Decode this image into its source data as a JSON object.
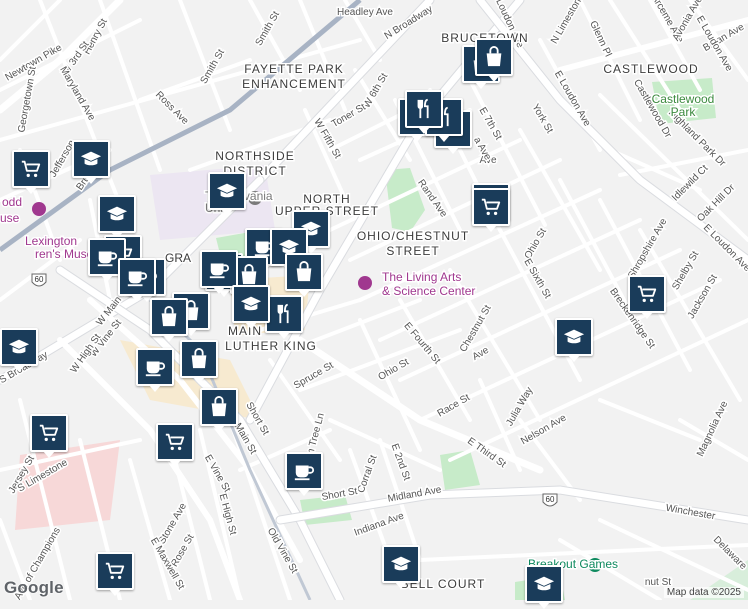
{
  "map": {
    "neighborhoods": [
      "BRUCETOWN",
      "CASTLEWOOD",
      "FAYETTE PARK",
      "ENHANCEMENT",
      "NORTHSIDE",
      "DISTRICT",
      "NORTH",
      "UPPER STREET",
      "OHIO/CHESTNUT",
      "STREET",
      "MAIN",
      "LUTHER KING",
      "BELL COURT"
    ],
    "places": [
      "Transylvania",
      "Univ",
      "Lexington",
      "ren's Museum",
      "The Living Arts",
      "& Science Center",
      "Castlewood",
      "Park",
      "Breakout Games",
      "odd",
      "use",
      "GRA"
    ],
    "streets": [
      "Henry St",
      "W 3rd St",
      "Newtown Pike",
      "Maryland Ave",
      "Georgetown St",
      "Jefferson",
      "Bruce St",
      "Ross Ave",
      "Smith St",
      "Smith St",
      "Headley Ave",
      "N Broadway",
      "N Loudon Ave",
      "N Limestone",
      "Arceme Ave",
      "Bryan Ave",
      "Glenn Pl",
      "Avonia Ave",
      "E Loudon Ave",
      "W 6th St",
      "Toner St",
      "E 7th St",
      "W Fifth St",
      "Rand Ave",
      "York St",
      "Castlewood Dr",
      "Highland Park Dr",
      "E Loudon Ave",
      "Idlewild Ct",
      "Oak Hill Dr",
      "E Loudon Ave",
      "Ohio St",
      "Shropshire Ave",
      "Shelby St",
      "Jackson St",
      "E Sixth St",
      "Breckenridge St",
      "W Main St",
      "W Vine St",
      "W High St",
      "S Broadway",
      "E Fourth St",
      "Ohio St",
      "Race St",
      "Julia Way",
      "Spruce St",
      "Short St",
      "Main St",
      "E Vine St",
      "Elm Tree Ln",
      "E Third St",
      "Nelson Ave",
      "Magnolia Ave",
      "Corral St",
      "E 2nd St",
      "Short St",
      "Midland Ave",
      "Winchester",
      "Delaware",
      "Jersey St",
      "S Limestone",
      "Stone Ave",
      "E High St",
      "Rose St",
      "E Maxwell St",
      "Old Vine St",
      "Indiana Ave",
      "Ave of Champions",
      "Fo",
      "Ave",
      "Ave",
      "Ave",
      "a Ave",
      "Chestnut St",
      "nut St",
      "Nati"
    ],
    "shields": [
      "60",
      "60"
    ],
    "logo_text": "Google",
    "attribution": "Map data ©2025"
  },
  "markers": [
    {
      "kind": "grocery"
    },
    {
      "kind": "school"
    },
    {
      "kind": "school"
    },
    {
      "kind": "school"
    },
    {
      "kind": "restaurant"
    },
    {
      "kind": "school"
    },
    {
      "kind": "shopping"
    },
    {
      "kind": "shopping"
    },
    {
      "kind": "restaurant"
    },
    {
      "kind": "restaurant"
    },
    {
      "kind": "school"
    },
    {
      "kind": "grocery"
    },
    {
      "kind": "cafe"
    },
    {
      "kind": "school"
    },
    {
      "kind": "grocery"
    },
    {
      "kind": "school"
    },
    {
      "kind": "cafe"
    },
    {
      "kind": "cafe"
    },
    {
      "kind": "cafe"
    },
    {
      "kind": "shopping"
    },
    {
      "kind": "restaurant"
    },
    {
      "kind": "shopping"
    },
    {
      "kind": "restaurant"
    },
    {
      "kind": "cafe"
    },
    {
      "kind": "school"
    },
    {
      "kind": "shopping"
    },
    {
      "kind": "shopping"
    },
    {
      "kind": "school"
    },
    {
      "kind": "cafe"
    },
    {
      "kind": "shopping"
    },
    {
      "kind": "shopping"
    },
    {
      "kind": "grocery"
    },
    {
      "kind": "grocery"
    },
    {
      "kind": "cafe"
    },
    {
      "kind": "grocery"
    },
    {
      "kind": "school"
    },
    {
      "kind": "school"
    },
    {
      "kind": "grocery"
    },
    {
      "kind": "grocery"
    }
  ],
  "colors": {
    "background": "#f2f2f2",
    "road": "#ffffff",
    "road_outline": "#dadce0",
    "highway": "#a8b3c4",
    "rail": "#9aa6b8",
    "park": "#c7ebc9",
    "campus": "#e8e3f0",
    "downtown": "#f7e7c5",
    "label": "#555555",
    "poi": "#a0388f",
    "marker": "#1a3c5a"
  }
}
